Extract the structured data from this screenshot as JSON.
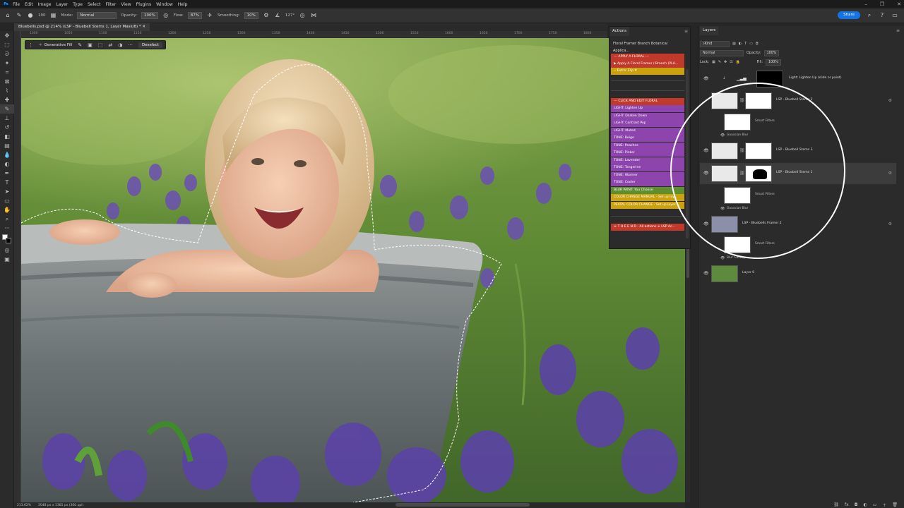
{
  "menubar": {
    "app_icon": "Ps",
    "items": [
      "File",
      "Edit",
      "Image",
      "Layer",
      "Type",
      "Select",
      "Filter",
      "View",
      "Plugins",
      "Window",
      "Help"
    ]
  },
  "options": {
    "mode_label": "Mode:",
    "mode_value": "Normal",
    "opacity_label": "Opacity:",
    "opacity_value": "100%",
    "flow_label": "Flow:",
    "flow_value": "87%",
    "smoothing_label": "Smoothing:",
    "smoothing_value": "10%",
    "angle_value": "127°",
    "brush_size": "100",
    "share_label": "Share"
  },
  "document": {
    "tab_title": "Bluebells.psd @ 214% (LSP - Bluebell Stems 1, Layer Mask/8) *",
    "zoom_status": "213.62%",
    "size_status": "2048 px x 1365 px (300 ppi)",
    "ruler_ticks": [
      "1000",
      "1050",
      "1100",
      "1150",
      "1200",
      "1250",
      "1300",
      "1350",
      "1400",
      "1450",
      "1500",
      "1550",
      "1600",
      "1650",
      "1700",
      "1750",
      "1800"
    ]
  },
  "context_taskbar": {
    "generative_fill_label": "Generative Fill",
    "deselect_label": "Deselect"
  },
  "actions_panel": {
    "tab_label": "Actions",
    "set_title": "Floral Framer Branch Botanical Applica...",
    "rows": [
      {
        "label": "--- APPLY A FLORAL ---",
        "color": "#c0392b"
      },
      {
        "label": "▶ Apply A Floral Framer / Branch (PLA...",
        "color": "#c0392b"
      },
      {
        "label": "-- Extra: Flip It",
        "color": "#c9a20d"
      },
      {
        "label": "--- CLICK AND EDIT FLORAL",
        "color": "#c0392b"
      },
      {
        "label": "LIGHT: Lighten Up",
        "color": "#8e44ad"
      },
      {
        "label": "LIGHT: Darken Down",
        "color": "#8e44ad"
      },
      {
        "label": "LIGHT: Contrast Pop",
        "color": "#8e44ad"
      },
      {
        "label": "LIGHT: Muted",
        "color": "#8e44ad"
      },
      {
        "label": "TONE: Beige",
        "color": "#8e44ad"
      },
      {
        "label": "TONE: Peaches",
        "color": "#8e44ad"
      },
      {
        "label": "TONE: Pinker",
        "color": "#8e44ad"
      },
      {
        "label": "TONE: Lavender",
        "color": "#8e44ad"
      },
      {
        "label": "TONE: Tangerine",
        "color": "#8e44ad"
      },
      {
        "label": "TONE: Warmer",
        "color": "#8e44ad"
      },
      {
        "label": "TONE: Cooler",
        "color": "#8e44ad"
      },
      {
        "label": "BLUR PAINT: You Choose",
        "color": "#5e8e2e"
      },
      {
        "label": "COLOR CHANGE MANUAL - Set up lay...",
        "color": "#c9a20d"
      },
      {
        "label": "PEATAL COLOR CHANGE - Set up layer...",
        "color": "#c9a20d"
      },
      {
        "label": "☠ T H E  E N D - All actions ☠ LSP Ac...",
        "color": "#c0392b"
      }
    ]
  },
  "layers_panel": {
    "tab_label": "Layers",
    "kind_label": "Kind",
    "blend_mode": "Normal",
    "opacity_label": "Opacity:",
    "opacity_value": "100%",
    "lock_label": "Lock:",
    "fill_label": "Fill:",
    "fill_value": "100%",
    "layers": [
      {
        "name": "Light: Lighten Up (slide or paint)",
        "kind": "adjustment"
      },
      {
        "name": "LSP - Bluebell Stems 2",
        "kind": "smart"
      },
      {
        "name": "LSP - Bluebell Stems 3",
        "kind": "smart"
      },
      {
        "name": "LSP - Bluebell Stems 1",
        "kind": "smart"
      },
      {
        "name": "LSP - Bluebells Framer 2",
        "kind": "smart"
      },
      {
        "name": "Layer 0",
        "kind": "pixel"
      }
    ],
    "smart_filters_label": "Smart Filters",
    "gaussian_blur_label": "Gaussian Blur",
    "blur_gallery_label": "Blur Gallery"
  },
  "icons": {
    "visibility": "eye-icon",
    "smart_object": "smart-object-icon",
    "home": "home-icon",
    "search": "search-icon"
  }
}
